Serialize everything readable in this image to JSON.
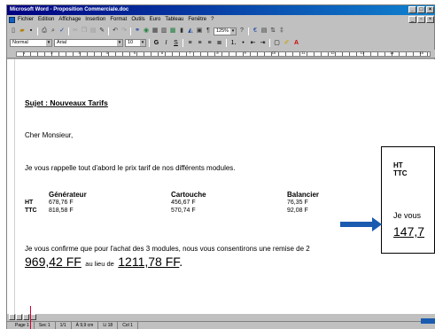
{
  "window": {
    "title": "Microsoft Word - Proposition Commerciale.doc"
  },
  "menu": [
    "Fichier",
    "Edition",
    "Affichage",
    "Insertion",
    "Format",
    "Outils",
    "Euro",
    "Tableau",
    "Fenêtre",
    "?"
  ],
  "toolbar": {
    "zoom": "125%"
  },
  "format_bar": {
    "style": "Normal",
    "font": "Arial",
    "size": "10"
  },
  "ruler_numbers": [
    "1",
    "2",
    "3",
    "4",
    "5",
    "6",
    "7",
    "8",
    "9",
    "10",
    "11",
    "12",
    "13",
    "14",
    "15"
  ],
  "document": {
    "subject": "Sujet : Nouveaux Tarifs",
    "greeting": "Cher Monsieur,",
    "intro": "Je vous rappelle tout d'abord le prix tarif de nos différents modules.",
    "table": {
      "columns": [
        "Générateur",
        "Cartouche",
        "Balancier"
      ],
      "rows": [
        {
          "label": "HT",
          "values": [
            "678,76 F",
            "456,67 F",
            "76,35 F"
          ]
        },
        {
          "label": "TTC",
          "values": [
            "818,58 F",
            "570,74 F",
            "92,08 F"
          ]
        }
      ]
    },
    "confirm": "Je vous confirme que pour l'achat des 3 modules, nous vous consentirons une remise de 2",
    "total_new": "969,42 FF",
    "au_lieu_de": "au lieu de",
    "total_old": "1211,78 FF",
    "total_end": "."
  },
  "callout": {
    "line1": "HT",
    "line2": "TTC",
    "line3": "Je vous",
    "line4": "147,7"
  },
  "status": {
    "page": "Page 1",
    "section": "Sec 1",
    "pages": "1/1",
    "position": "À 9,9 cm",
    "line": "Li 18",
    "col": "Col 1"
  },
  "colors": {
    "arrow": "#1a5bb0",
    "titlebar": "#000080"
  }
}
